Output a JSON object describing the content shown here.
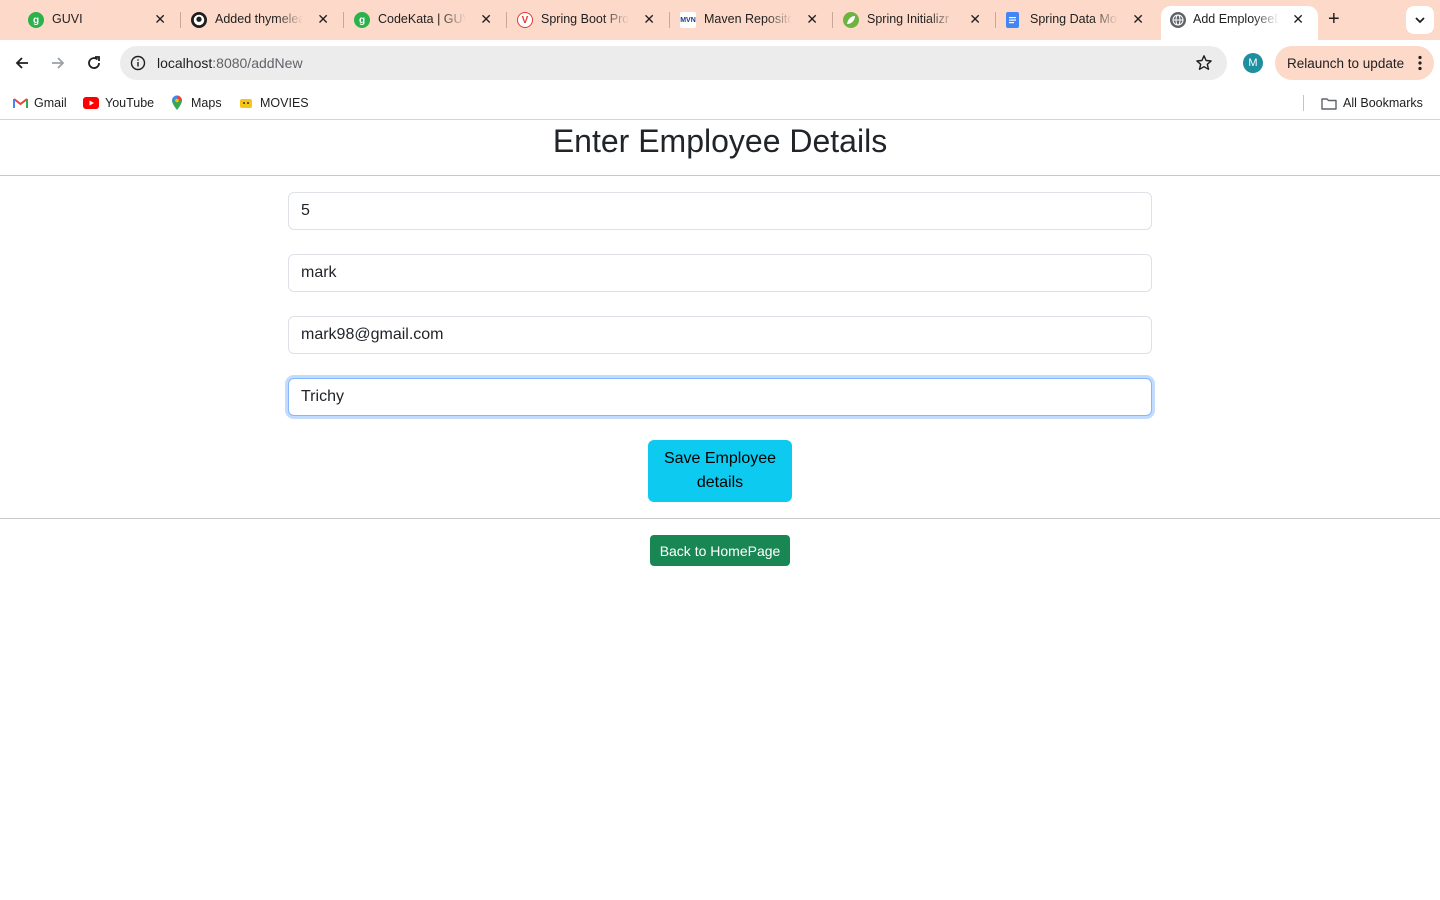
{
  "browser": {
    "tabs": [
      {
        "title": "GUVI",
        "icon": "guvi-icon",
        "color": "#2bb24c"
      },
      {
        "title": "Added thymeleaf",
        "icon": "github-icon",
        "color": "#1f1f1f"
      },
      {
        "title": "CodeKata | GUVI",
        "icon": "guvi-icon",
        "color": "#2bb24c"
      },
      {
        "title": "Spring Boot Project",
        "icon": "pinterest-like-icon",
        "color": "#e53935"
      },
      {
        "title": "Maven Repository",
        "icon": "mvn-icon",
        "color": "#1a3a8f"
      },
      {
        "title": "Spring Initializr",
        "icon": "spring-icon",
        "color": "#6db33f"
      },
      {
        "title": "Spring Data MongoDB",
        "icon": "docs-icon",
        "color": "#4285f4"
      },
      {
        "title": "Add EmployeeDetails",
        "icon": "globe-icon",
        "color": "#5f6368",
        "active": true
      }
    ],
    "new_tab_label": "+",
    "url_host": "localhost",
    "url_path": ":8080/addNew",
    "profile_initial": "M",
    "relaunch_label": "Relaunch to update",
    "bookmarks": [
      {
        "label": "Gmail",
        "icon": "gmail-icon"
      },
      {
        "label": "YouTube",
        "icon": "youtube-icon"
      },
      {
        "label": "Maps",
        "icon": "maps-icon"
      },
      {
        "label": "MOVIES",
        "icon": "folder-emoji-icon"
      }
    ],
    "all_bookmarks_label": "All Bookmarks"
  },
  "page": {
    "title": "Enter Employee Details",
    "fields": {
      "id": "5",
      "name": "mark",
      "email": "mark98@gmail.com",
      "location": "Trichy"
    },
    "save_label": "Save Employee details",
    "back_label": "Back to HomePage"
  },
  "colors": {
    "tabstrip": "#fcd9c8",
    "save_button": "#0dcaf0",
    "back_button": "#198754",
    "focus_ring": "#86b7fe"
  }
}
